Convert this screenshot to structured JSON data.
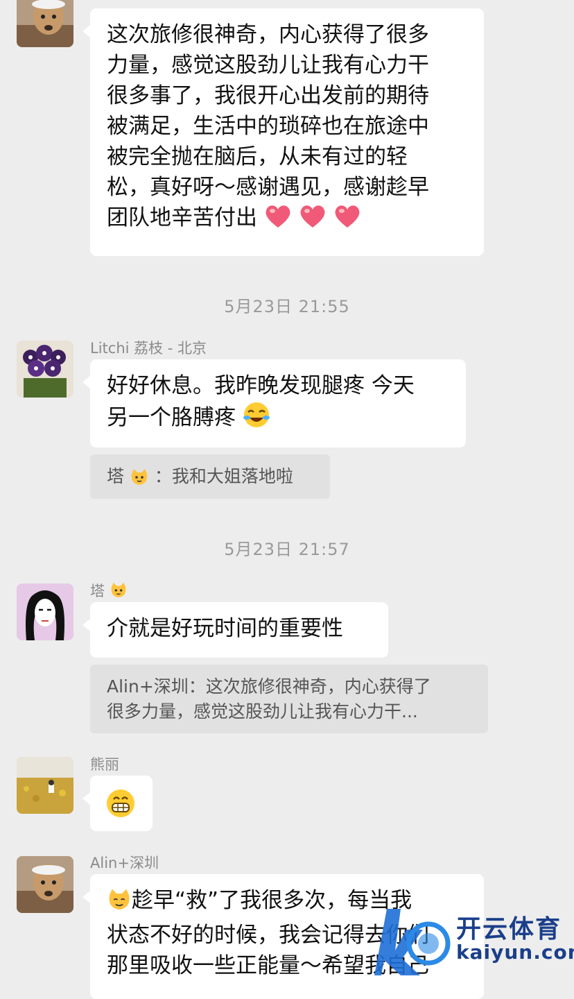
{
  "messages": {
    "m1": {
      "sender": "Alin+深圳",
      "lines": [
        "这次旅修很神奇，内心获得了很多",
        "力量，感觉这股劲儿让我有心力干",
        "很多事了，我很开心出发前的期待",
        "被满足，生活中的琐碎也在旅途中",
        "被完全抛在脑后，从未有过的轻",
        "松，真好呀～感谢遇见，感谢趁早",
        "团队地辛苦付出"
      ],
      "emoji": "heart-emoji ×3"
    },
    "time1": "5月23日 21:55",
    "m2": {
      "sender": "Litchi 荔枝 - 北京",
      "lines": [
        "好好休息。我昨晚发现腿疼 今天",
        "另一个胳膊疼"
      ],
      "emoji": "laugh-cry-emoji",
      "quote_prefix": "塔",
      "quote_text": "：我和大姐落地啦"
    },
    "time2": "5月23日 21:57",
    "m3": {
      "sender": "塔",
      "lines": [
        "介就是好玩时间的重要性"
      ],
      "quote_lines": [
        "Alin+深圳：这次旅修很神奇，内心获得了",
        "很多力量，感觉这股劲儿让我有心力干..."
      ]
    },
    "m4": {
      "sender": "熊丽",
      "emoji": "grin-emoji"
    },
    "m5": {
      "sender": "Alin+深圳",
      "lines": [
        "趁早“救”了我很多次，每当我",
        "状态不好的时候，我会记得去你们",
        "那里吸收一些正能量～希望我自己"
      ]
    }
  },
  "watermark": {
    "title": "开云体育",
    "subtitle": "kaiyun.com"
  },
  "colors": {
    "background": "#ededed",
    "bubble": "#ffffff",
    "quote": "#e1e1e1",
    "timestamp": "#9a9a9a",
    "watermark_blue": "#1a3f8a"
  }
}
